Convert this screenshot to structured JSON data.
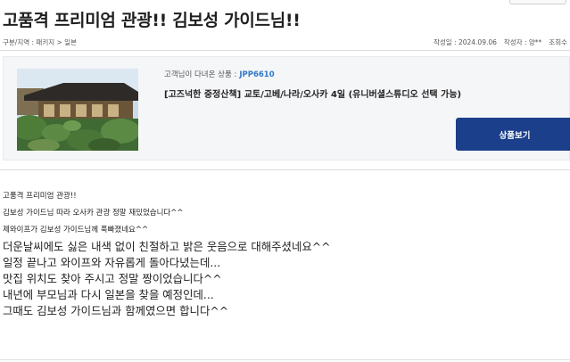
{
  "post": {
    "title": "고품격 프리미엄 관광!! 김보성 가이드님!!",
    "breadcrumb": "구분/지역 : 패키지 > 일본",
    "date_label": "작성일 : 2024.09.06",
    "author_label": "작성자 : 양**",
    "views_label": "조회수"
  },
  "product": {
    "caption": "고객님이 다녀온 상품 :",
    "code": "JPP6610",
    "name": "[고즈넉한 중정산책] 교토/고베/나라/오사카 4일 (유니버셜스튜디오 선택 가능)",
    "image_icon": "japanese-garden-photo",
    "view_button_label": "상품보기"
  },
  "content": {
    "small_lines": [
      "고품격 프리미엄 관광!!",
      "김보성 가이드님 따라 오사카 관광 정말 재밌었습니다^^",
      "제와이프가 김보성 가이드님께 푹빠졌네요^^"
    ],
    "large_lines": [
      "더운날씨에도 싫은 내색 없이 친절하고 밝은 웃음으로 대해주셨네요^^",
      "일정 끝나고 와이프와 자유롭게 돌아다녔는데...",
      "맛집 위치도 찾아 주시고 정말 짱이었습니다^^",
      "내년에 부모님과 다시 일본을 찾을 예정인데...",
      "그때도 김보성 가이드님과 함께였으면 합니다^^"
    ]
  },
  "colors": {
    "accent_blue": "#1b3f8b",
    "code_blue": "#2e78c7",
    "panel_bg": "#f5f6f8"
  }
}
